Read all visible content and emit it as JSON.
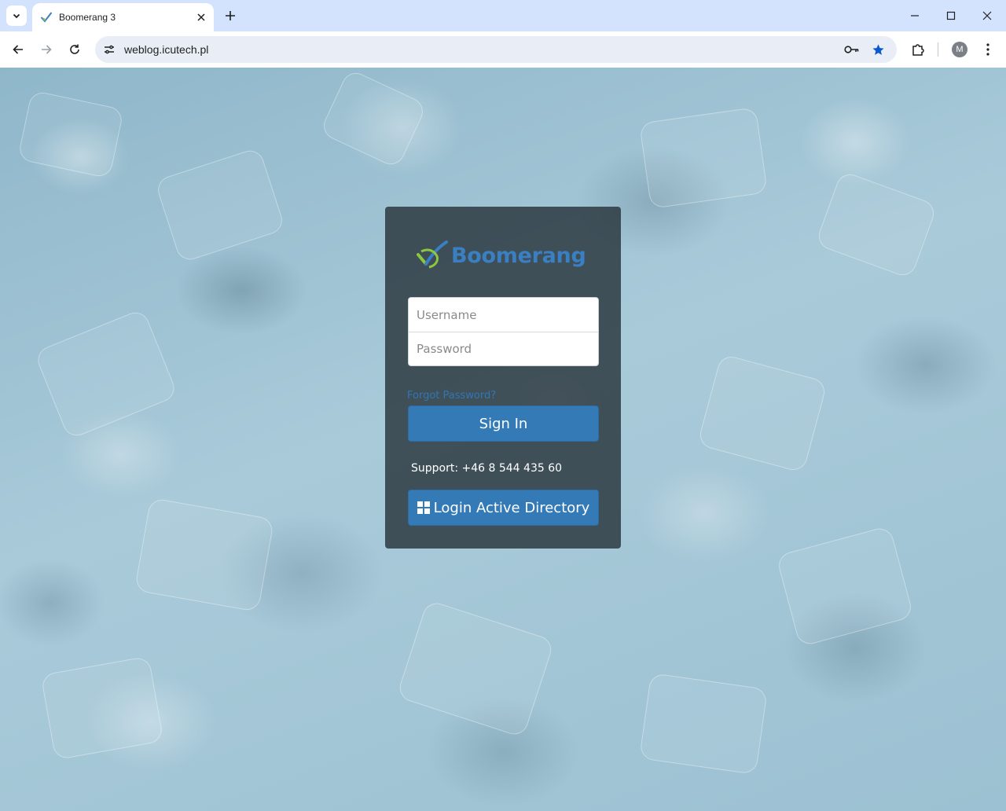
{
  "browser": {
    "tab_title": "Boomerang 3",
    "url": "weblog.icutech.pl",
    "profile_initial": "M",
    "icons": {
      "tab_search": "chevron-down-icon",
      "favicon": "boomerang-check-icon",
      "tab_close": "close-icon",
      "new_tab": "plus-icon",
      "minimize": "minimize-icon",
      "maximize": "maximize-icon",
      "close_window": "close-icon",
      "back": "arrow-left-icon",
      "forward": "arrow-right-icon",
      "reload": "reload-icon",
      "site_info": "tune-icon",
      "password_key": "key-icon",
      "bookmark": "star-icon",
      "extensions": "puzzle-icon",
      "menu": "more-vert-icon"
    },
    "colors": {
      "tab_strip": "#d3e3fd",
      "omnibox": "#e9eef6",
      "bookmark_star": "#0b57d0"
    }
  },
  "login": {
    "logo_text": "Boomerang",
    "username_placeholder": "Username",
    "password_placeholder": "Password",
    "forgot_password": "Forgot Password?",
    "sign_in": "Sign In",
    "support": "Support: +46 8 544 435 60",
    "ad_login": "Login Active Directory",
    "colors": {
      "primary_button": "#337ab7",
      "logo_blue": "#3a7fc1",
      "logo_green": "#8dc63f",
      "link": "#3176b5",
      "panel": "#28343c"
    }
  }
}
